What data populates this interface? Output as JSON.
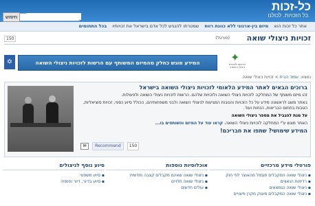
{
  "header": {
    "logo": "כל-זכות",
    "tagline": "כל הזכויות. לכולנו.",
    "search_button": "חיפוש",
    "search_placeholder": ""
  },
  "intro": {
    "part1": "אתר כל זכות הוא",
    "bold1": "מיזם",
    "part2": "בין-ארגוני",
    "part3": "ללא כוונת רווח",
    "part4": "שמטרתו להנגיש לכל אדם בישראל את זכויותיו",
    "bold2": "בכל התחומים"
  },
  "page": {
    "title": "זכויות ניצולי שואה",
    "tag": "(פורטל)",
    "fb_count": "150"
  },
  "banner": {
    "text": "המידע מוגש כחלק מהמיזם המשותף עם הרשות לזכויות ניצולי השואה",
    "gov_icon": "menorah-emblem",
    "assoc_text": "הרשות לזכויות ניצולי השואה"
  },
  "breadcrumb": {
    "prefix": "נמצא:",
    "home": "עמוד הבית",
    "current": "זכויות ניצולי שואה"
  },
  "content": {
    "welcome": "ברוכים הבאים לאתר המידע הלאומי לזכויות ניצולי השואה בישראל",
    "p1": "זהו מיזם משותף של המחלקה לזכויות ניצולי השואה ולזכויות שלהם. הרשות לזכויות ניצולי השואה ולפעולות.",
    "p2": "באתר מוצג לראשונה מידע על כל הזכויות והטבות המגיעות לניצולי השואה ולבני משפחותיהם, הכולל סיוע כספי, זכויות סוציאליות, הטבות בתחום הבריאות, הנחות ועוד.",
    "p3_link": "על מנת להגביל את מספר ניצולי השואה",
    "p4": "האתר מוגש ע\"י המחלקה לזכויות ניצולי השואה.",
    "read_more": "קראו עוד על המיזם והשותפים בו...",
    "question": "המידע שימושי? שתפו את חבריכם!",
    "recommend": "Recommend",
    "share_count": "150"
  },
  "columns": {
    "col1_title": "פורטלי מידע מרכזיים",
    "col1_items": [
      "ניצולי שואה המקבלים תגמול מהאוצר לפי חוק",
      "רדיפות הנאצים",
      "ניצולי שואה הנמצאים",
      "ניצולי שואה המקבלים מענק מקרן פיצויים"
    ],
    "col2_title": "אוכלוסיות נוספות",
    "col2_items": [
      "ניצולי שואה שאינם מקבלים קצבה חודשית",
      "ניצולי שואה תלויים",
      "עולים חדשים"
    ],
    "col3_title": "סיוע נוסף לניצולים",
    "col3_items": [
      "סיוע משפטי",
      "סיוע בדיור, דיור ופנסיה"
    ]
  }
}
